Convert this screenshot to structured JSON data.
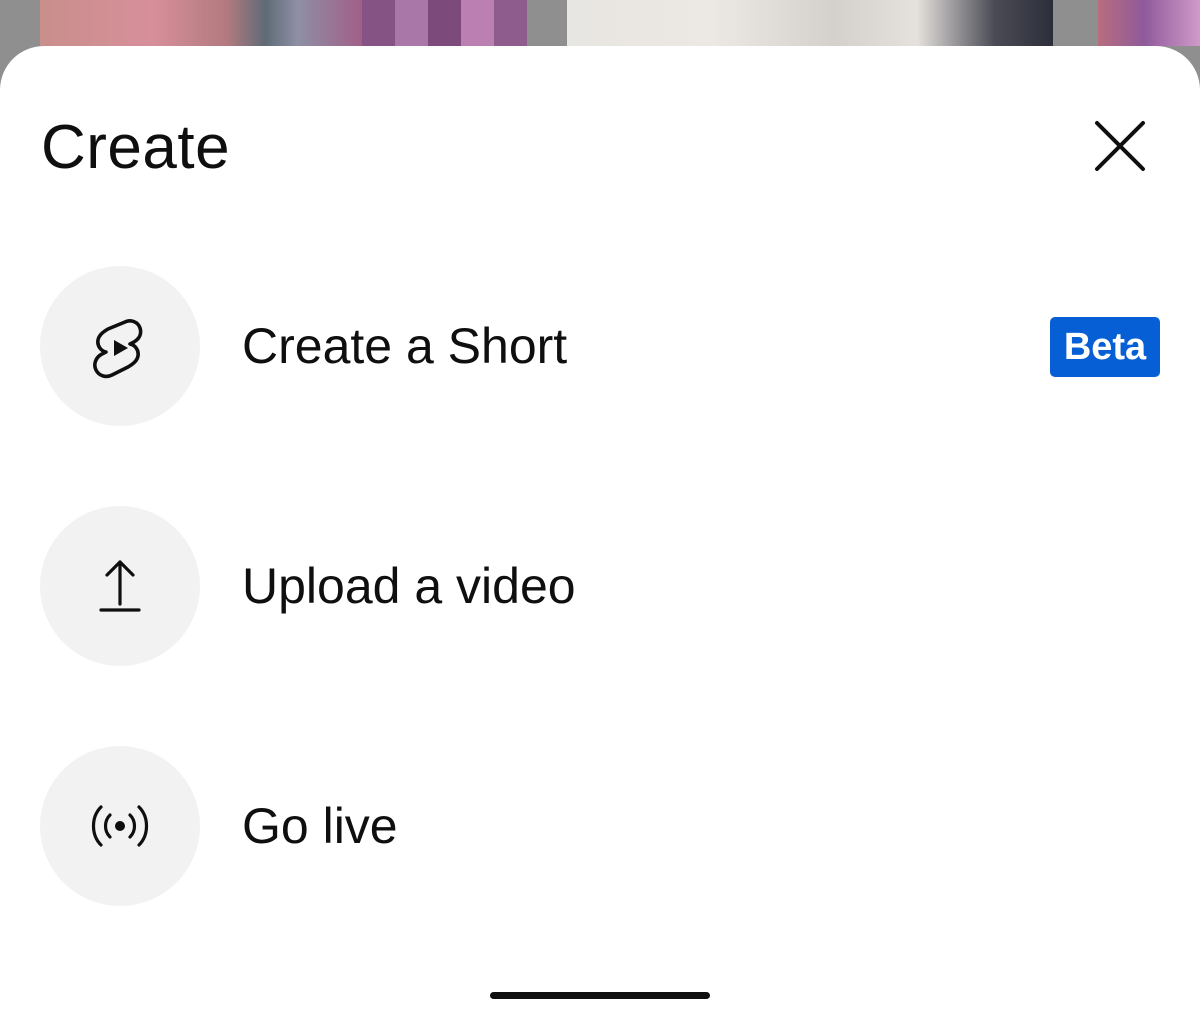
{
  "sheet": {
    "title": "Create"
  },
  "menu": {
    "items": [
      {
        "label": "Create a Short",
        "icon": "shorts-icon",
        "badge": "Beta"
      },
      {
        "label": "Upload a video",
        "icon": "upload-icon"
      },
      {
        "label": "Go live",
        "icon": "live-broadcast-icon"
      }
    ]
  },
  "colors": {
    "badge_background": "#065fd4",
    "icon_circle": "#f2f2f2",
    "text": "#0f0f0f"
  }
}
